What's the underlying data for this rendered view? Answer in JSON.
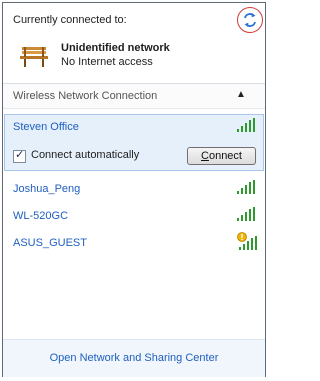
{
  "header": {
    "connected_to_label": "Currently connected to:",
    "network_name": "Unidentified network",
    "network_status": "No Internet access",
    "refresh_icon": "refresh-icon",
    "network_icon": "bench-icon"
  },
  "section": {
    "title": "Wireless Network Connection",
    "collapse_icon": "chevron-up-icon"
  },
  "networks": [
    {
      "name": "Steven Office",
      "signal_bars": 5,
      "icon": "signal-bars-icon",
      "selected": true
    },
    {
      "name": "Joshua_Peng",
      "signal_bars": 5,
      "icon": "signal-bars-icon",
      "selected": false
    },
    {
      "name": "WL-520GC",
      "signal_bars": 5,
      "icon": "signal-bars-icon",
      "selected": false
    },
    {
      "name": "ASUS_GUEST",
      "signal_bars": 5,
      "icon": "unsecured-signal-icon",
      "selected": false
    }
  ],
  "selected_network": {
    "connect_automatically_label": "Connect automatically",
    "connect_automatically_checked": true,
    "connect_button_label": "Connect"
  },
  "footer": {
    "link_label": "Open Network and Sharing Center"
  },
  "colors": {
    "link": "#1f5fbf",
    "selection_bg": "#e6f0fb",
    "signal": "#2e9a2e",
    "highlight_circle": "#d23b3b"
  }
}
